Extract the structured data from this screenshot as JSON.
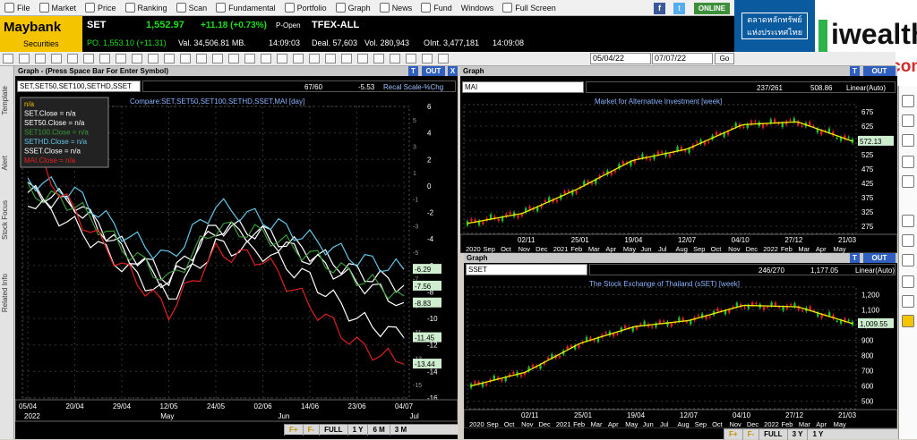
{
  "menu": [
    {
      "label": "File",
      "icon": "file-icon"
    },
    {
      "label": "Market",
      "icon": "market-icon"
    },
    {
      "label": "Price",
      "icon": "price-icon"
    },
    {
      "label": "Ranking",
      "icon": "ranking-icon"
    },
    {
      "label": "Scan",
      "icon": "scan-icon"
    },
    {
      "label": "Fundamental",
      "icon": "fundamental-icon"
    },
    {
      "label": "Portfolio",
      "icon": "portfolio-icon"
    },
    {
      "label": "Graph",
      "icon": "graph-icon"
    },
    {
      "label": "News",
      "icon": "news-icon"
    },
    {
      "label": "Fund",
      "icon": "fund-icon"
    },
    {
      "label": "Windows",
      "icon": ""
    },
    {
      "label": "Full Screen",
      "icon": "fullscreen-icon"
    }
  ],
  "status": {
    "online": "ONLINE"
  },
  "brand": {
    "name": "Maybank",
    "sub": "Securities"
  },
  "ticker": {
    "symbol": "SET",
    "price": "1,552.97",
    "change": "+11.18 (+0.73%)",
    "session": "P-Open",
    "po": "PO. 1,553.10 (+11.31)",
    "val": "Val. 34,506.81 MB.",
    "time1": "14:09:03",
    "tfex": "TFEX-ALL",
    "deal": "Deal. 57,603",
    "vol": "Vol. 280,943",
    "oint": "OInt. 3,477,181",
    "time2": "14:09:08"
  },
  "ad": {
    "text": "ตลาดหลักทรัพย์แห่งประเทศไทย"
  },
  "watermark": {
    "brand": "iwealthz",
    "url": "iwealthz.com"
  },
  "dates": {
    "from": "05/04/22",
    "to": "07/07/22",
    "go": "Go"
  },
  "sidebar": [
    "Template",
    "Alert",
    "Stock Focus",
    "Related Info"
  ],
  "nav": {
    "f_plus": "F+",
    "f_minus": "F-",
    "full": "FULL",
    "y1": "1 Y",
    "m6": "6 M",
    "y3": "3 Y",
    "m3": "3 M"
  },
  "left": {
    "title": "Graph - (Press Space Bar For Enter Symbol)",
    "t": "T",
    "out": "OUT",
    "x": "X",
    "symbol": "SET,SET50,SET100,SETHD,SSET",
    "count": "67/60",
    "readout": "-5.53",
    "scale": "Recal Scale-%Chg",
    "chart_title": "Compare:SET,SET50,SET100,SETHD,SSET,MAI [day]",
    "legend": [
      {
        "text": "n/a",
        "color": "#f0c000"
      },
      {
        "text": "SET.Close  = n/a",
        "color": "#ffffff"
      },
      {
        "text": "SET50.Close  = n/a",
        "color": "#ffffff"
      },
      {
        "text": "SET100.Close = n/a",
        "color": "#3a9a3a"
      },
      {
        "text": "SETHD.Close  = n/a",
        "color": "#63c7e6"
      },
      {
        "text": "SSET.Close  = n/a",
        "color": "#ffffff"
      },
      {
        "text": "MAI.Close  = n/a",
        "color": "#e02020"
      }
    ],
    "y_ticks": [
      "6",
      "4",
      "2",
      "0",
      "-2",
      "-4",
      "-6",
      "-8",
      "-10",
      "-12",
      "-14",
      "-16"
    ],
    "y_ticks_minor": [
      "5",
      "3",
      "1",
      "-1",
      "-3",
      "-5",
      "-7",
      "-9",
      "-11",
      "-13",
      "-15"
    ],
    "value_tags": [
      {
        "text": "-6.29",
        "y": -6.29
      },
      {
        "text": "-7.56",
        "y": -7.56
      },
      {
        "text": "-8.83",
        "y": -8.83
      },
      {
        "text": "-11.45",
        "y": -11.45
      },
      {
        "text": "-13.44",
        "y": -13.44
      }
    ],
    "x_ticks": [
      "05/04",
      "20/04",
      "29/04",
      "12/05",
      "24/05",
      "02/06",
      "14/06",
      "23/06",
      "04/07"
    ],
    "x_months": [
      "2022",
      "May",
      "Jun",
      "Jul"
    ]
  },
  "right_top": {
    "title": "Graph",
    "t": "T",
    "out": "OUT",
    "symbol": "MAI",
    "count": "237/261",
    "last": "508.86",
    "scale": "Linear(Auto)",
    "chart_title": "Market for Alternative Investment [week]",
    "y_ticks": [
      "675",
      "625",
      "575",
      "525",
      "475",
      "425",
      "375",
      "325",
      "275"
    ],
    "tag": "572.13",
    "x_ticks": [
      "02/11",
      "25/01",
      "19/04",
      "12/07",
      "04/10",
      "27/12",
      "21/03"
    ],
    "x_months": [
      "2020",
      "Sep",
      "Oct",
      "Nov",
      "Dec",
      "2021",
      "Feb",
      "Mar",
      "Apr",
      "May",
      "Jun",
      "Jul",
      "Aug",
      "Sep",
      "Oct",
      "Nov",
      "Dec",
      "2022",
      "Feb",
      "Mar",
      "Apr",
      "May"
    ]
  },
  "right_bot": {
    "title": "Graph",
    "t": "T",
    "out": "OUT",
    "symbol": "SSET",
    "count": "246/270",
    "last": "1,177.05",
    "scale": "Linear(Auto)",
    "chart_title": "The Stock Exchange of Thailand (sSET) [week]",
    "y_ticks": [
      "1,200",
      "1,100",
      "1,000",
      "900",
      "800",
      "700",
      "600",
      "500"
    ],
    "tag": "1,009.55",
    "x_ticks": [
      "02/11",
      "25/01",
      "19/04",
      "12/07",
      "04/10",
      "27/12",
      "21/03"
    ],
    "x_months": [
      "2020",
      "Sep",
      "Oct",
      "Nov",
      "Dec",
      "2021",
      "Feb",
      "Mar",
      "Apr",
      "May",
      "Jun",
      "Jul",
      "Aug",
      "Sep",
      "Oct",
      "Nov",
      "Dec",
      "2022",
      "Feb",
      "Mar",
      "Apr",
      "May"
    ]
  },
  "chart_data": [
    {
      "type": "line",
      "title": "Compare:SET,SET50,SET100,SETHD,SSET,MAI [day]",
      "ylabel": "%Chg",
      "ylim": [
        -16,
        6
      ],
      "categories": [
        "05/04",
        "20/04",
        "29/04",
        "12/05",
        "24/05",
        "02/06",
        "14/06",
        "23/06",
        "04/07"
      ],
      "series": [
        {
          "name": "SET",
          "color": "#ffffff",
          "values": [
            -0.5,
            -1.5,
            -4.5,
            -7,
            -3,
            -3.5,
            -5,
            -6.5,
            -7.5
          ]
        },
        {
          "name": "SET50",
          "color": "#ffffff",
          "values": [
            -0.3,
            -1.2,
            -4.8,
            -7.4,
            -3.2,
            -3.7,
            -5.5,
            -7.2,
            -8.8
          ]
        },
        {
          "name": "SET100",
          "color": "#3a9a3a",
          "values": [
            -0.4,
            -1.4,
            -4.6,
            -7.2,
            -3.1,
            -3.6,
            -5.2,
            -6.9,
            -8.3
          ]
        },
        {
          "name": "SETHD",
          "color": "#63c7e6",
          "values": [
            0.5,
            -0.5,
            -3.5,
            -5.5,
            -1.5,
            -2.5,
            -4,
            -5.5,
            -6.3
          ]
        },
        {
          "name": "SSET",
          "color": "#ffffff",
          "values": [
            -1,
            -3,
            -6,
            -8.5,
            -4.5,
            -5,
            -7,
            -10,
            -11.45
          ]
        },
        {
          "name": "MAI",
          "color": "#e02020",
          "values": [
            3,
            -2,
            -6,
            -9.5,
            -5,
            -5.5,
            -9,
            -12,
            -13.44
          ]
        }
      ]
    },
    {
      "type": "line",
      "title": "Market for Alternative Investment [week]",
      "ylim": [
        250,
        700
      ],
      "categories": [
        "02/11",
        "25/01",
        "19/04",
        "12/07",
        "04/10",
        "27/12",
        "21/03"
      ],
      "series": [
        {
          "name": "MAI",
          "color": "#f0f000",
          "values": [
            285,
            320,
            405,
            505,
            545,
            630,
            640,
            572.13
          ]
        }
      ]
    },
    {
      "type": "line",
      "title": "The Stock Exchange of Thailand (sSET) [week]",
      "ylim": [
        450,
        1250
      ],
      "categories": [
        "02/11",
        "25/01",
        "19/04",
        "12/07",
        "04/10",
        "27/12",
        "21/03"
      ],
      "series": [
        {
          "name": "SSET",
          "color": "#f0f000",
          "values": [
            600,
            690,
            880,
            990,
            1030,
            1130,
            1120,
            1009.55
          ]
        }
      ]
    }
  ]
}
